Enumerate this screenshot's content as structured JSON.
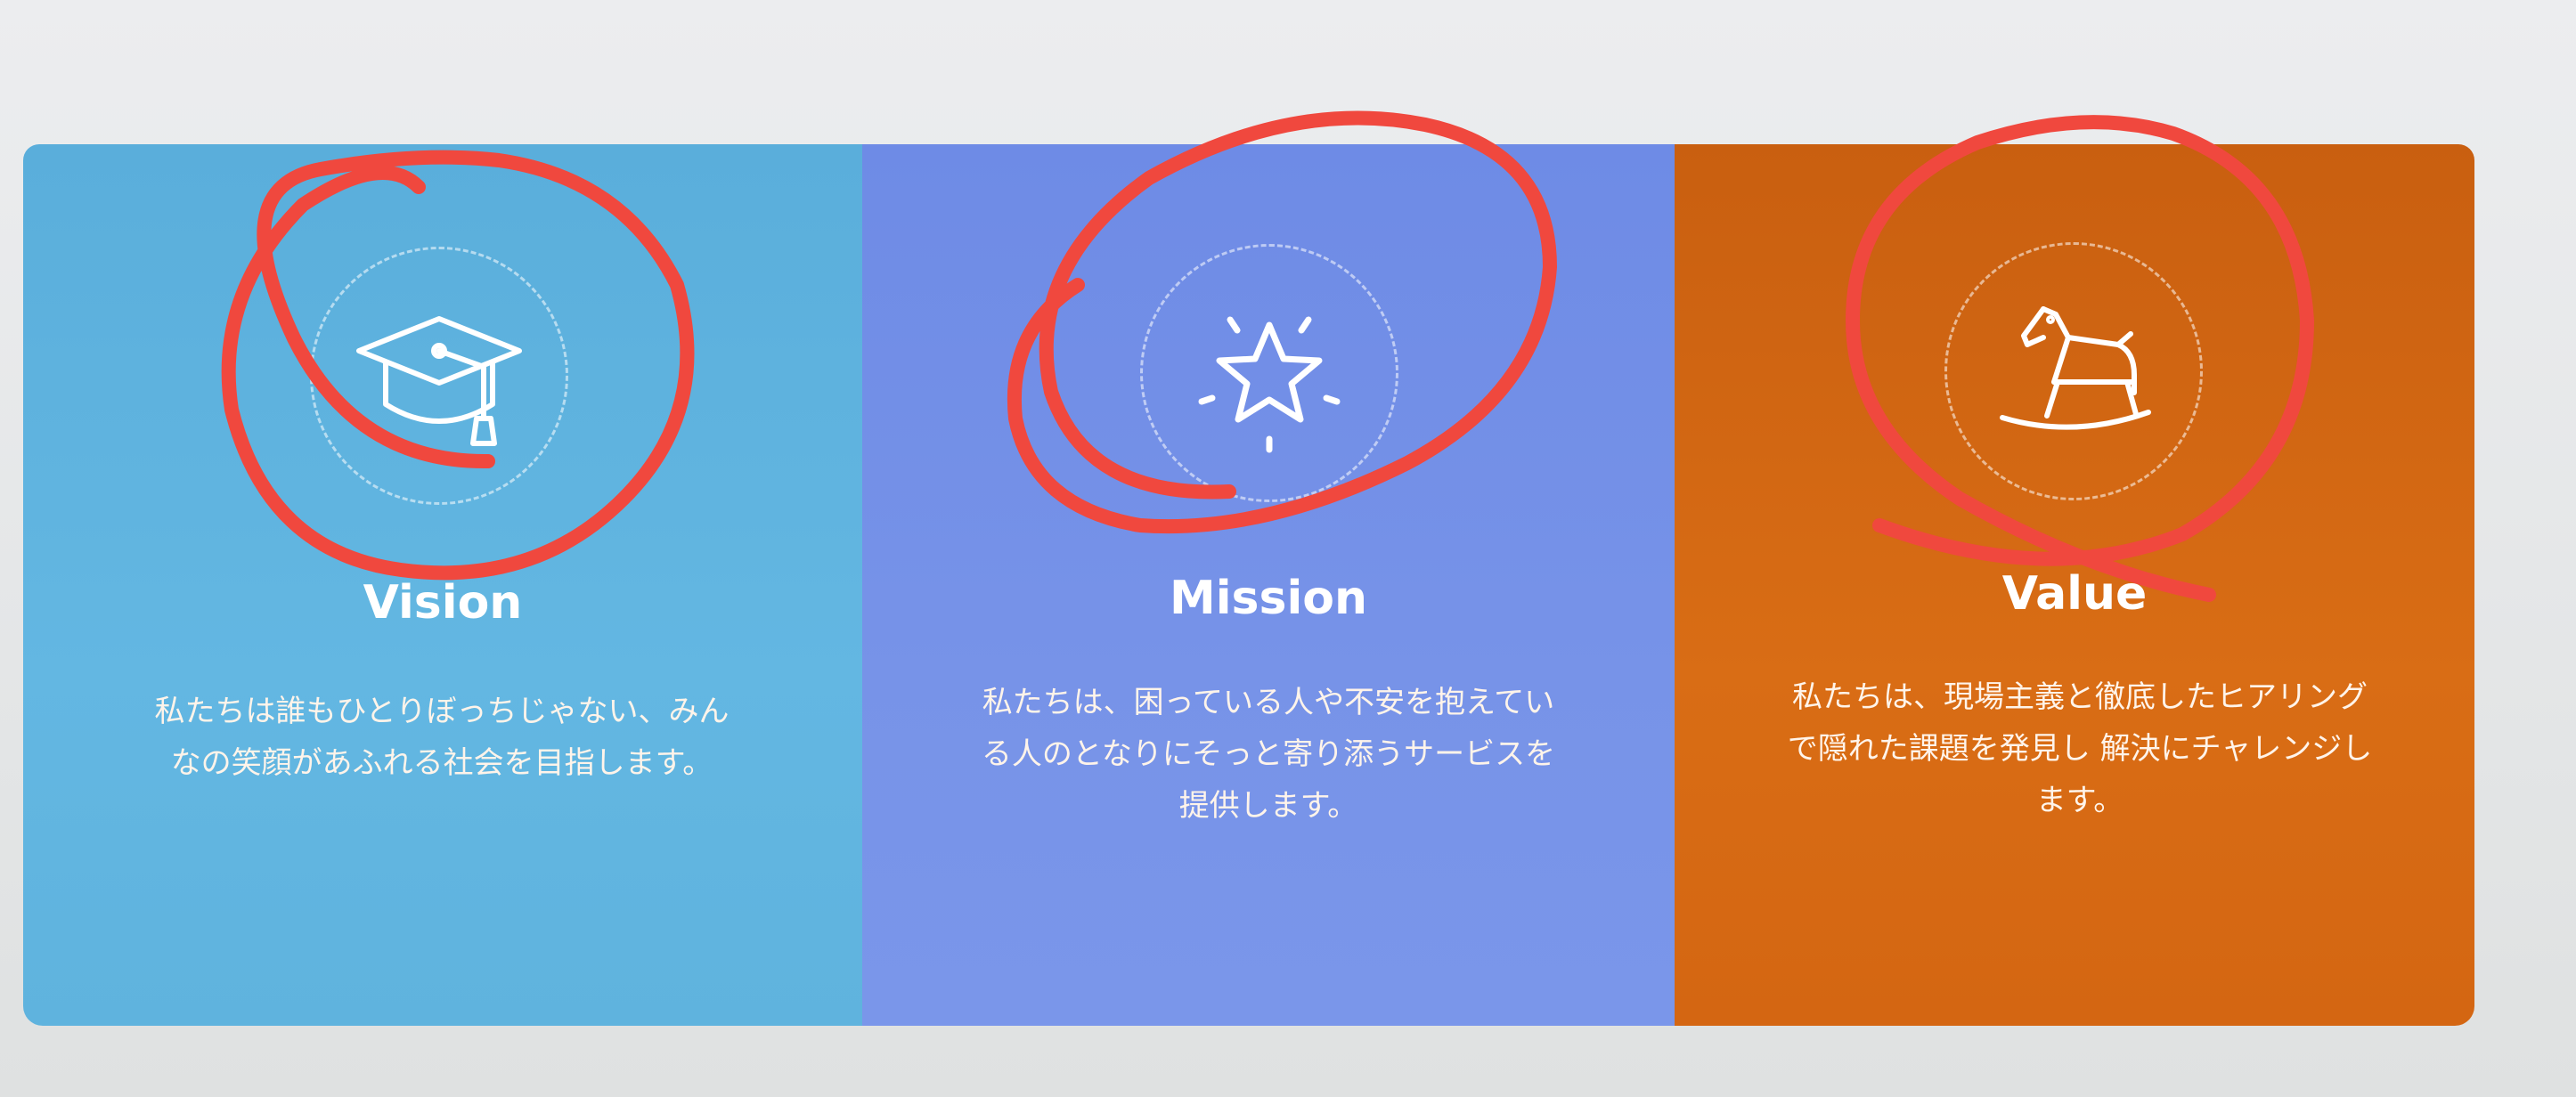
{
  "panels": {
    "vision": {
      "title": "Vision",
      "icon": "graduation-cap-icon",
      "lines": [
        "私たちは誰もひとりぼっちじゃない、みん",
        "なの笑顔があふれる社会を目指します。"
      ],
      "color": "#5fb3de"
    },
    "mission": {
      "title": "Mission",
      "icon": "star-icon",
      "lines": [
        "私たちは、困っている人や不安を抱えてい",
        "る人のとなりにそっと寄り添うサービスを",
        "提供します。"
      ],
      "color": "#7793e8"
    },
    "value": {
      "title": "Value",
      "icon": "rocking-horse-icon",
      "lines": [
        "私たちは、現場主義と徹底したヒアリング",
        "で隠れた課題を発見し 解決にチャレンジし",
        "ます。"
      ],
      "color": "#d96d15"
    }
  },
  "annotations": {
    "marker": "red-circle-scribbles",
    "color": "#f0483e"
  }
}
